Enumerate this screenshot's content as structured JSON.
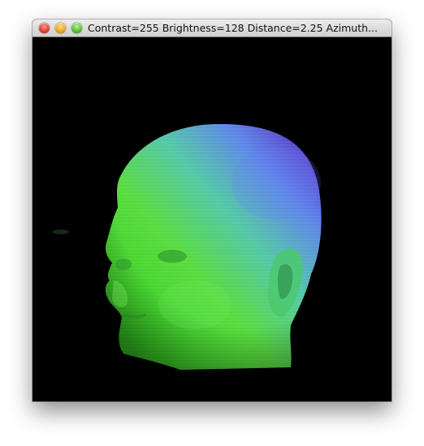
{
  "window": {
    "title": "Contrast=255 Brightness=128 Distance=2.25 Azimuth..."
  },
  "controls": {
    "close_icon": "close-icon",
    "minimize_icon": "minimize-icon",
    "zoom_icon": "zoom-icon"
  },
  "viewport": {
    "content": "volume-rendered-head",
    "background": "#000000",
    "colors": [
      "#48e03c",
      "#5ad0a0",
      "#5f7bf0",
      "#6a4fd8"
    ]
  }
}
